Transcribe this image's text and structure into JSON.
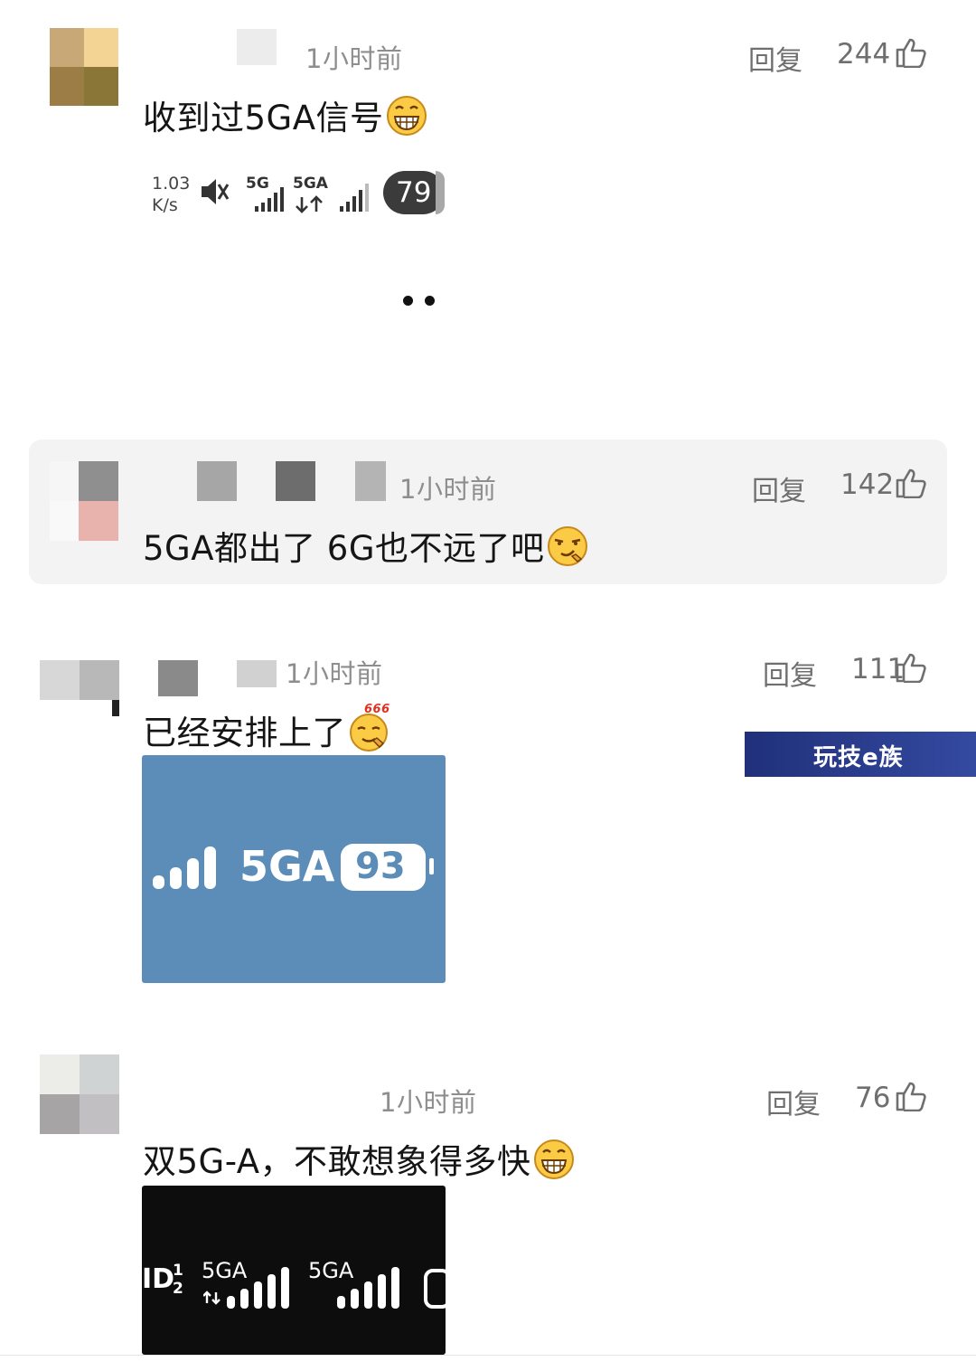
{
  "comments": [
    {
      "time": "1小时前",
      "reply": "回复",
      "likes": "244",
      "text": "收到过5GA信号",
      "status_bar": {
        "speed_value": "1.03",
        "speed_unit": "K/s",
        "net1": "5G",
        "net2": "5GA",
        "battery": "79"
      }
    },
    {
      "time": "1小时前",
      "reply": "回复",
      "likes": "142",
      "text": "5GA都出了 6G也不远了吧"
    },
    {
      "time": "1小时前",
      "reply": "回复",
      "likes": "111",
      "text": "已经安排上了",
      "emoji_badge": "666",
      "image": {
        "network": "5GA",
        "battery": "93"
      }
    },
    {
      "time": "1小时前",
      "reply": "回复",
      "likes": "76",
      "text": "双5G-A，不敢想象得多快",
      "image": {
        "sim_id": "ID",
        "sim_1": "1",
        "sim_2": "2",
        "net1": "5GA",
        "net2": "5GA"
      }
    }
  ],
  "watermark": "玩技e族",
  "colors": {
    "highlight_bg": "#f3f3f3",
    "meta_gray": "#8e8e8e",
    "image_blue": "#5b8db8",
    "watermark_bg": "#2b3d86"
  }
}
